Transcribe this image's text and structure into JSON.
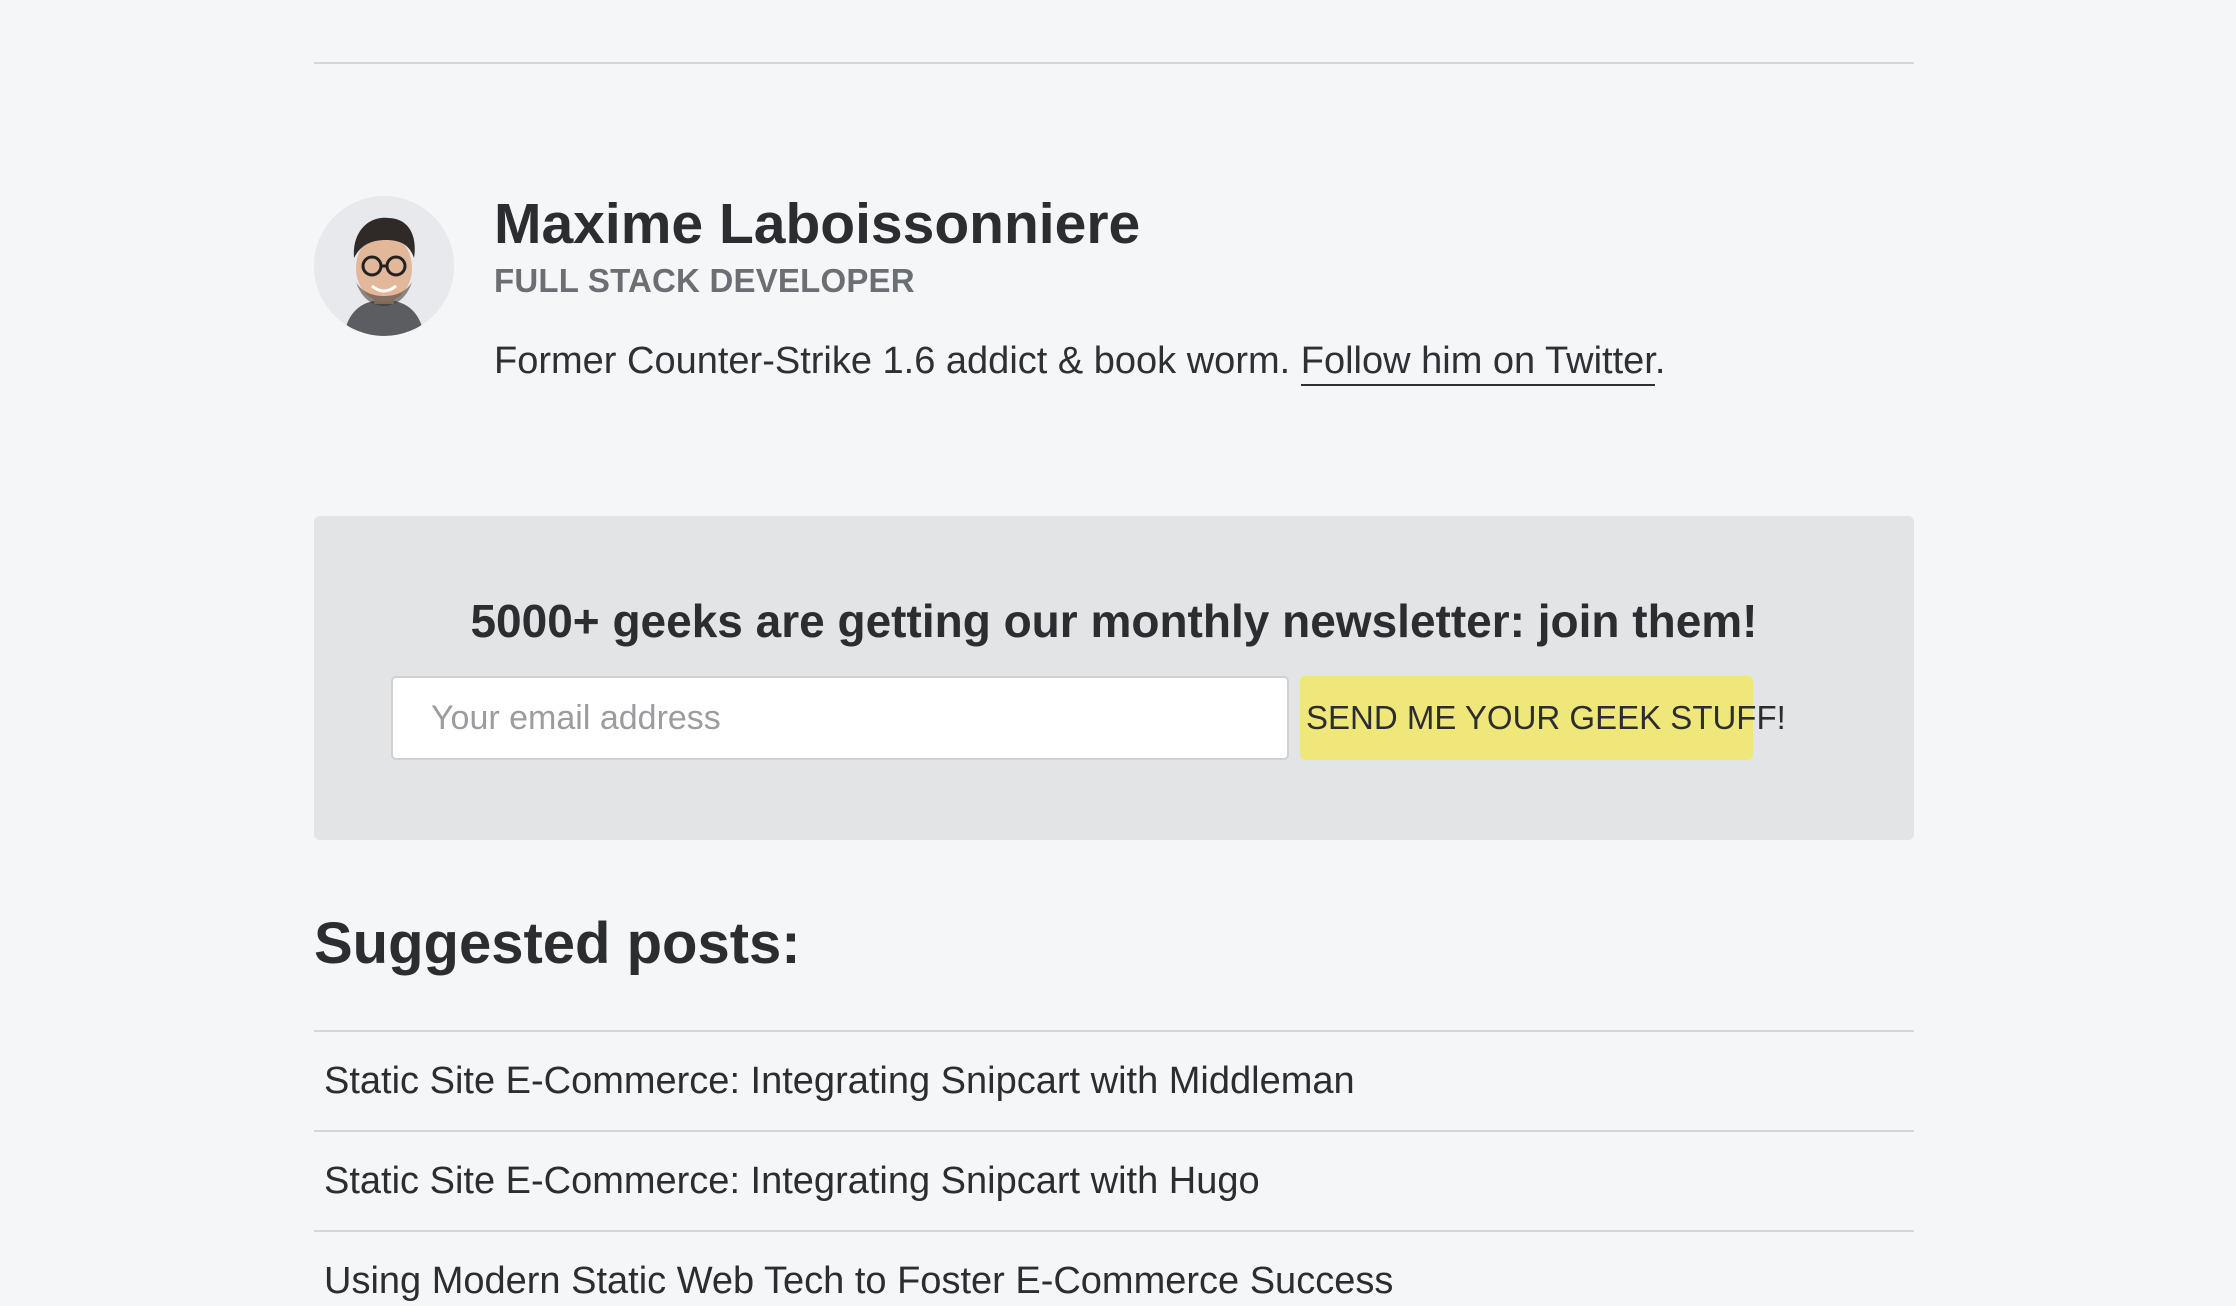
{
  "author": {
    "name": "Maxime Laboissonniere",
    "role": "FULL STACK DEVELOPER",
    "bio_text": "Former Counter-Strike 1.6 addict & book worm. ",
    "twitter_link": "Follow him on Twitter",
    "bio_end": "."
  },
  "newsletter": {
    "title": "5000+ geeks are getting our monthly newsletter: join them!",
    "email_placeholder": "Your email address",
    "email_value": "",
    "submit_label": "SEND ME YOUR GEEK STUFF!",
    "button_color": "#f0e77a"
  },
  "suggested": {
    "title": "Suggested posts:",
    "posts": [
      {
        "title": "Static Site E-Commerce: Integrating Snipcart with Middleman"
      },
      {
        "title": "Static Site E-Commerce: Integrating Snipcart with Hugo"
      },
      {
        "title": "Using Modern Static Web Tech to Foster E-Commerce Success"
      }
    ]
  }
}
